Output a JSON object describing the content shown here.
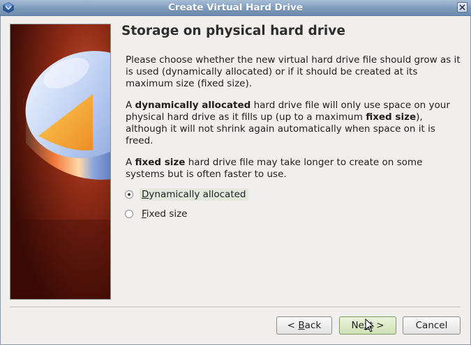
{
  "window": {
    "title": "Create Virtual Hard Drive",
    "close_label": "close"
  },
  "page": {
    "title": "Storage on physical hard drive",
    "para1": "Please choose whether the new virtual hard drive file should grow as it is used (dynamically allocated) or if it should be created at its maximum size (fixed size).",
    "para2": {
      "t1": "A ",
      "b1": "dynamically allocated",
      "t2": " hard drive file will only use space on your physical hard drive as it fills up (up to a maximum ",
      "b2": "fixed size",
      "t3": "), although it will not shrink again automatically when space on it is freed."
    },
    "para3": {
      "t1": "A ",
      "b1": "fixed size",
      "t2": " hard drive file may take longer to create on some systems but is often faster to use."
    }
  },
  "options": [
    {
      "pre": "",
      "mnemonic": "D",
      "post": "ynamically allocated",
      "checked": true
    },
    {
      "pre": "",
      "mnemonic": "F",
      "post": "ixed size",
      "checked": false
    }
  ],
  "buttons": {
    "back": {
      "pre": "< ",
      "mnemonic": "B",
      "post": "ack"
    },
    "next": {
      "pre": "Ne",
      "mnemonic": "x",
      "post": "t >"
    },
    "cancel": "Cancel"
  },
  "icons": {
    "app": "virtualbox-icon",
    "close": "close-icon",
    "illustration": "hard-drive-pie-illustration",
    "cursor": "mouse-pointer-icon"
  },
  "colors": {
    "titlebar": "#7f9bbd",
    "default_button": "#cfe1b6",
    "illustration_bg": "#8e2a14"
  }
}
